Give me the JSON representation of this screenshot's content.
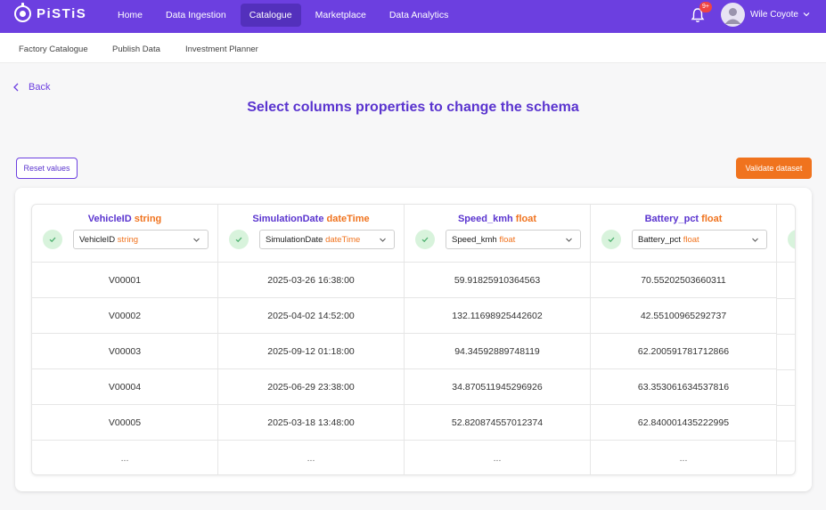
{
  "app": {
    "brand": "PiSTiS"
  },
  "nav": {
    "items": [
      "Home",
      "Data Ingestion",
      "Catalogue",
      "Marketplace",
      "Data Analytics"
    ],
    "active": "Catalogue"
  },
  "notifications": {
    "badge": "9+"
  },
  "user": {
    "name": "Wile Coyote"
  },
  "subnav": {
    "items": [
      "Factory Catalogue",
      "Publish Data",
      "Investment Planner"
    ]
  },
  "back_label": "Back",
  "page_title": "Select columns properties to change the schema",
  "actions": {
    "reset": "Reset values",
    "validate": "Validate dataset"
  },
  "colors": {
    "primary": "#6c3fe0",
    "accent": "#f0731e",
    "valid": "#d8f3dc"
  },
  "columns": [
    {
      "name": "VehicleID",
      "type": "string",
      "values": [
        "V00001",
        "V00002",
        "V00003",
        "V00004",
        "V00005",
        "..."
      ]
    },
    {
      "name": "SimulationDate",
      "type": "dateTime",
      "values": [
        "2025-03-26 16:38:00",
        "2025-04-02 14:52:00",
        "2025-09-12 01:18:00",
        "2025-06-29 23:38:00",
        "2025-03-18 13:48:00",
        "..."
      ]
    },
    {
      "name": "Speed_kmh",
      "type": "float",
      "values": [
        "59.91825910364563",
        "132.11698925442602",
        "94.34592889748119",
        "34.870511945296926",
        "52.820874557012374",
        "..."
      ]
    },
    {
      "name": "Battery_pct",
      "type": "float",
      "values": [
        "70.55202503660311",
        "42.55100965292737",
        "62.200591781712866",
        "63.353061634537816",
        "62.840001435222995",
        "..."
      ]
    }
  ]
}
